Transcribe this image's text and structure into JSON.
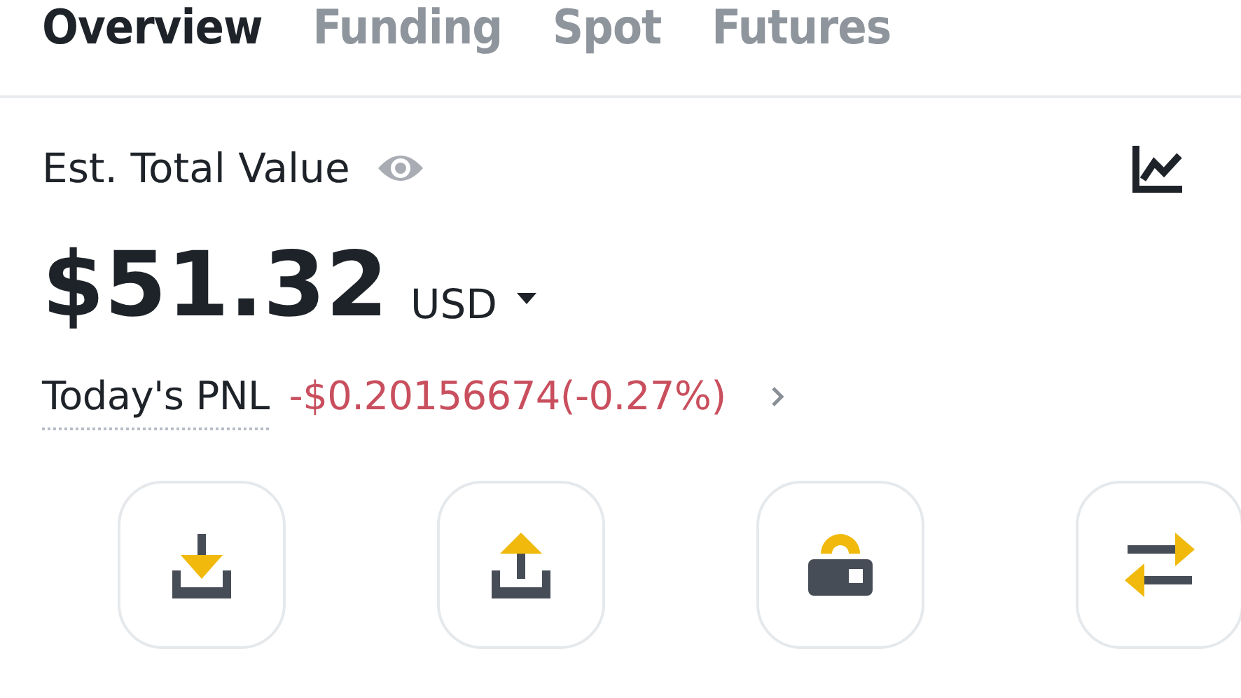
{
  "tabs": [
    {
      "label": "Overview",
      "selected": true
    },
    {
      "label": "Funding",
      "selected": false
    },
    {
      "label": "Spot",
      "selected": false
    },
    {
      "label": "Futures",
      "selected": false
    }
  ],
  "total": {
    "label": "Est. Total Value",
    "amount": "$51.32",
    "currency": "USD"
  },
  "pnl": {
    "label": "Today's PNL",
    "value": "-$0.20156674(-0.27%)"
  },
  "actions": [
    {
      "kind": "deposit"
    },
    {
      "kind": "withdraw"
    },
    {
      "kind": "lock"
    },
    {
      "kind": "transfer"
    }
  ]
}
